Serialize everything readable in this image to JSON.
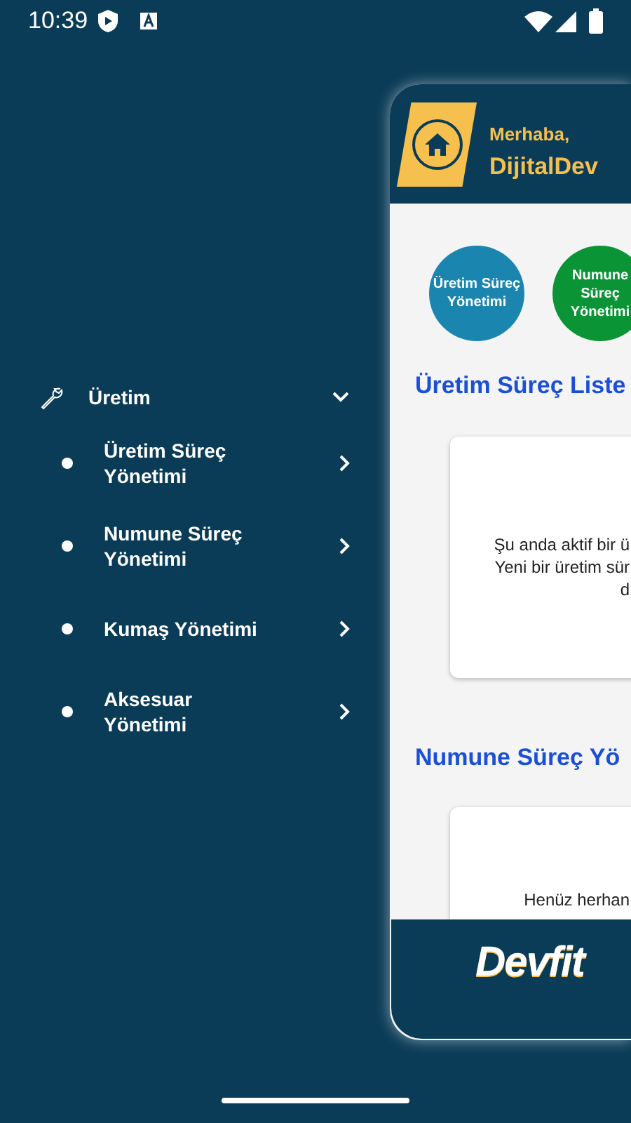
{
  "status_bar": {
    "time": "10:39"
  },
  "drawer": {
    "groups": [
      {
        "label": "Üretim",
        "expanded": true,
        "children": [
          {
            "label": "Üretim Süreç Yönetimi"
          },
          {
            "label": "Numune Süreç Yönetimi"
          },
          {
            "label": "Kumaş Yönetimi"
          },
          {
            "label": "Aksesuar Yönetimi"
          }
        ]
      }
    ]
  },
  "app": {
    "greeting": "Merhaba,",
    "user": "DijitalDev",
    "shortcuts": [
      {
        "label": "Üretim Süreç Yönetimi",
        "color": "#1a86b0"
      },
      {
        "label": "Numune Süreç Yönetimi",
        "color": "#0b9436"
      }
    ],
    "sections": [
      {
        "title": "Üretim Süreç Liste",
        "message": [
          "Şu anda aktif bir ü",
          "Yeni bir üretim sür",
          "d"
        ]
      },
      {
        "title": "Numune Süreç Yö",
        "message": [
          "Henüz herhan"
        ]
      }
    ],
    "footer_logo": "Devfit"
  }
}
